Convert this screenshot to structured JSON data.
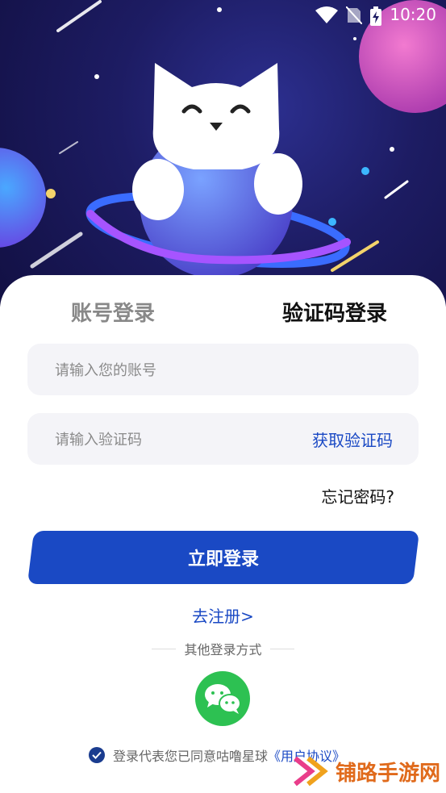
{
  "status_bar": {
    "time": "10:20",
    "icons": [
      "wifi-icon",
      "no-sim-icon",
      "battery-charging-icon"
    ]
  },
  "tabs": {
    "account": "账号登录",
    "code": "验证码登录",
    "active": "code"
  },
  "account_field": {
    "placeholder": "请输入您的账号",
    "value": ""
  },
  "code_field": {
    "placeholder": "请输入验证码",
    "value": "",
    "get_code_label": "获取验证码"
  },
  "forgot_label": "忘记密码?",
  "login_button_label": "立即登录",
  "register_label": "去注册>",
  "other_login_label": "其他登录方式",
  "agreement": {
    "checked": true,
    "text": "登录代表您已同意咕噜星球",
    "link": "《用户协议》"
  },
  "watermark": {
    "text": "铺路手游网"
  },
  "colors": {
    "accent": "#1a49c4",
    "wechat": "#2dc152",
    "hero_bg": "#1d1c63"
  }
}
